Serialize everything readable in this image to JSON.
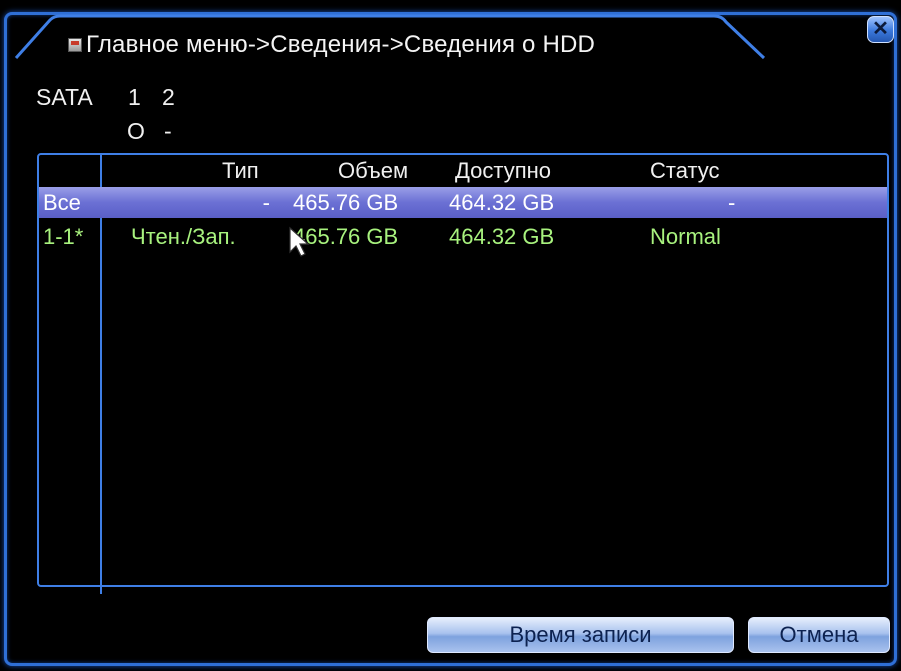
{
  "window": {
    "title": "Главное меню->Сведения->Сведения о HDD",
    "close_icon": "close-icon"
  },
  "sata": {
    "label": "SATA",
    "ports": [
      "1",
      "2"
    ],
    "states": [
      "O",
      "-"
    ]
  },
  "table": {
    "headers": [
      "Тип",
      "Объем",
      "Доступно",
      "Статус"
    ],
    "rows": [
      {
        "id": "Все",
        "type": "-",
        "capacity": "465.76 GB",
        "available": "464.32 GB",
        "status": "-"
      },
      {
        "id": "1-1*",
        "type": "Чтен./Зап.",
        "capacity": "465.76 GB",
        "available": "464.32 GB",
        "status": "Normal"
      }
    ]
  },
  "buttons": {
    "record_time": "Время записи",
    "cancel": "Отмена"
  },
  "colors": {
    "accent": "#3f7fe6",
    "selected_row": "#6b70d4",
    "data_text": "#a8f27e"
  }
}
